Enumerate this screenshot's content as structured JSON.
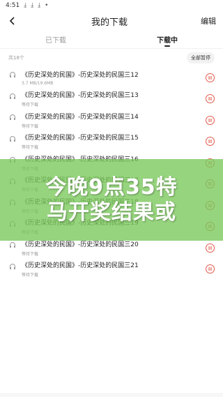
{
  "status_bar": {
    "time": "4:51",
    "icons": [
      "download-icon",
      "download-icon",
      "download-icon",
      "dot-icon"
    ]
  },
  "nav": {
    "title": "我的下载",
    "edit_label": "编辑"
  },
  "tabs": [
    {
      "label": "已下载",
      "active": false
    },
    {
      "label": "下载中",
      "active": true
    }
  ],
  "summary": {
    "count_text": "共18个",
    "pause_all_label": "全部暂停"
  },
  "items": [
    {
      "title": "《历史深处的民国》-历史深处的民国三12",
      "status": "3.7 MB/19.6MB"
    },
    {
      "title": "《历史深处的民国》-历史深处的民国三13",
      "status": "等待下载"
    },
    {
      "title": "《历史深处的民国》-历史深处的民国三14",
      "status": "等待下载"
    },
    {
      "title": "《历史深处的民国》-历史深处的民国三15",
      "status": "等待下载"
    },
    {
      "title": "《历史深处的民国》-历史深处的民国三16",
      "status": "等待下载"
    },
    {
      "title": "《历史深处的民国》-历史深处的民国三17",
      "status": "等待下载"
    },
    {
      "title": "《历史深处的民国》-历史深处的民国三18",
      "status": "等待下载"
    },
    {
      "title": "《历史深处的民国》-历史深处的民国三19",
      "status": "等待下载"
    },
    {
      "title": "《历史深处的民国》-历史深处的民国三20",
      "status": "等待下载"
    },
    {
      "title": "《历史深处的民国》-历史深处的民国三21",
      "status": "等待下载"
    }
  ],
  "overlay": {
    "line1": "今晚9点35特",
    "line2": "马开奖结果或"
  },
  "colors": {
    "accent": "#e05a4a",
    "overlay": "#78c85a"
  }
}
